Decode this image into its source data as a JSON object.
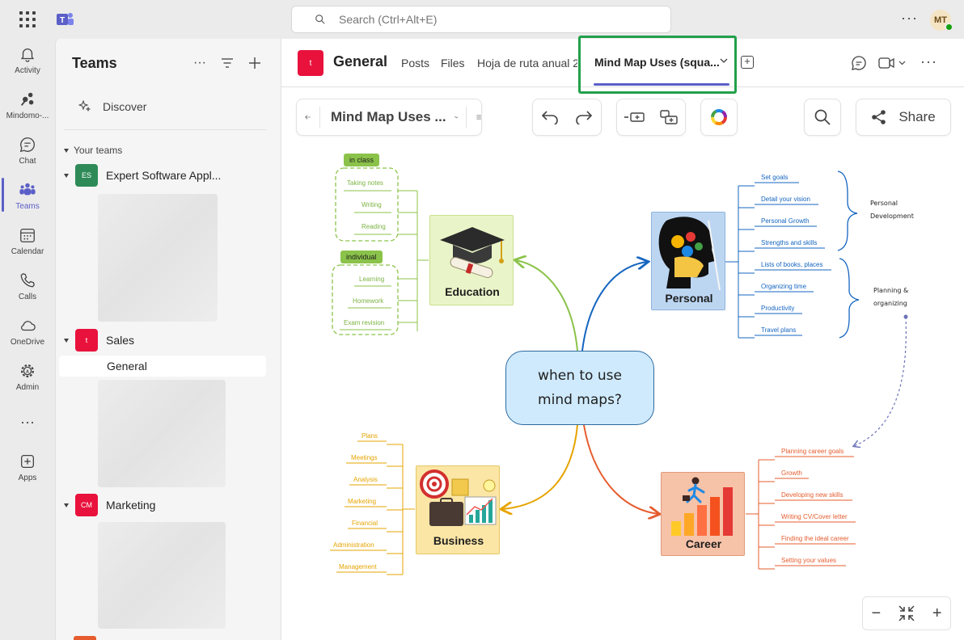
{
  "topbar": {
    "search_placeholder": "Search (Ctrl+Alt+E)",
    "avatar_initials": "MT"
  },
  "rail": {
    "items": [
      {
        "label": "Activity",
        "icon": "bell-icon"
      },
      {
        "label": "Mindomo-...",
        "icon": "mindomo-icon"
      },
      {
        "label": "Chat",
        "icon": "chat-icon"
      },
      {
        "label": "Teams",
        "icon": "teams-icon"
      },
      {
        "label": "Calendar",
        "icon": "calendar-icon"
      },
      {
        "label": "Calls",
        "icon": "phone-icon"
      },
      {
        "label": "OneDrive",
        "icon": "cloud-icon"
      },
      {
        "label": "Admin",
        "icon": "admin-gear-icon"
      },
      {
        "label": "Apps",
        "icon": "apps-plus-icon"
      }
    ]
  },
  "panel": {
    "title": "Teams",
    "discover": "Discover",
    "your_teams": "Your teams",
    "teams": [
      {
        "badge": "ES",
        "name": "Expert Software Appl...",
        "color": "#2e8b57"
      },
      {
        "badge": "t",
        "name": "Sales",
        "color": "#e8123c"
      },
      {
        "badge": "CM",
        "name": "Marketing",
        "color": "#e8123c"
      }
    ],
    "active_channel": "General"
  },
  "channel": {
    "badge": "t",
    "name": "General",
    "tabs": [
      "Posts",
      "Files",
      "Hoja de ruta anual 2"
    ],
    "active_tab": "Mind Map Uses (squa..."
  },
  "mindmap": {
    "title": "Mind Map Uses ...",
    "share_label": "Share",
    "central": "when to use mind maps?",
    "education": {
      "label": "Education",
      "tag_in_class": "in class",
      "in_class_items": [
        "Taking notes",
        "Writing",
        "Reading"
      ],
      "tag_individual": "individual",
      "individual_items": [
        "Learning",
        "Homework",
        "Exam revision"
      ]
    },
    "personal": {
      "label": "Personal",
      "items": [
        "Set goals",
        "Detail your vision",
        "Personal Growth",
        "Strengths and skills",
        "Lists of books, places",
        "Organizing time",
        "Productivity",
        "Travel plans"
      ],
      "group1_line1": "Personal",
      "group1_line2": "Development",
      "group2_line1": "Planning &",
      "group2_line2": "organizing"
    },
    "business": {
      "label": "Business",
      "items": [
        "Plans",
        "Meetings",
        "Analysis",
        "Marketing",
        "Financial",
        "Administration",
        "Management"
      ]
    },
    "career": {
      "label": "Career",
      "items": [
        "Planning career goals",
        "Growth",
        "Developing new skills",
        "Writing CV/Cover letter",
        "Finding the ideal career",
        "Setting  your values"
      ]
    },
    "colors": {
      "education": "#8bc34a",
      "personal": "#1565c0",
      "business": "#e6a400",
      "career": "#e65c2e"
    }
  }
}
